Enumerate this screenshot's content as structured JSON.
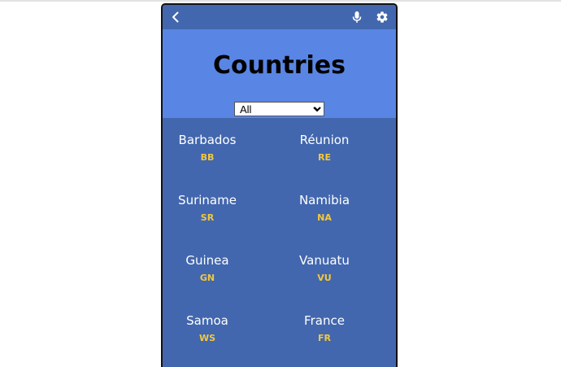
{
  "header": {
    "title": "Countries",
    "filter": {
      "selected": "All",
      "options": [
        "All"
      ]
    }
  },
  "icons": {
    "back": "chevron-left-icon",
    "mic": "microphone-icon",
    "settings": "gear-icon"
  },
  "colors": {
    "app_bar": "#4267ae",
    "header_bg": "#5985e4",
    "grid_bg": "#4267ae",
    "country_name": "#ffffff",
    "country_code": "#f3c83a"
  },
  "countries": [
    {
      "name": "Barbados",
      "code": "BB"
    },
    {
      "name": "Réunion",
      "code": "RE"
    },
    {
      "name": "Suriname",
      "code": "SR"
    },
    {
      "name": "Namibia",
      "code": "NA"
    },
    {
      "name": "Guinea",
      "code": "GN"
    },
    {
      "name": "Vanuatu",
      "code": "VU"
    },
    {
      "name": "Samoa",
      "code": "WS"
    },
    {
      "name": "France",
      "code": "FR"
    }
  ]
}
